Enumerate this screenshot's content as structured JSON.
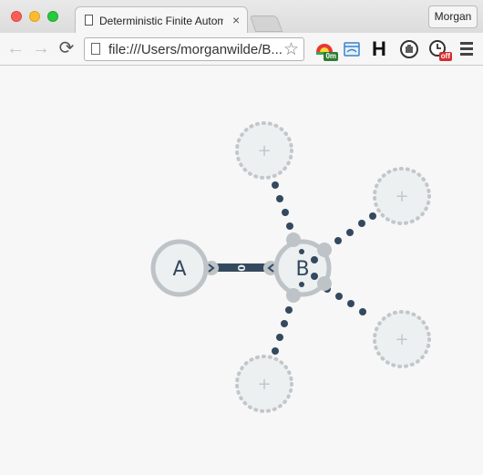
{
  "browser": {
    "tab_title": "Deterministic Finite Automa",
    "tab_close": "×",
    "profile_name": "Morgan",
    "url": "file:///Users/morganwilde/B...",
    "nav": {
      "back": "←",
      "forward": "→",
      "reload": "⟳"
    },
    "star": "☆",
    "extensions": {
      "timer_badge": "0m",
      "h_label": "H",
      "clock_badge": "off"
    }
  },
  "automaton": {
    "colors": {
      "edge": "#34495e",
      "node_fill": "#ecf0f1",
      "node_stroke": "#bdc3c7",
      "ghost_stroke": "#c2c7cb",
      "plus": "#c2c7cb"
    },
    "states": [
      {
        "id": "A",
        "label": "A"
      },
      {
        "id": "B",
        "label": "B"
      }
    ],
    "transition_label": "0",
    "ghost_symbol": "+",
    "ghost_count": 4
  }
}
